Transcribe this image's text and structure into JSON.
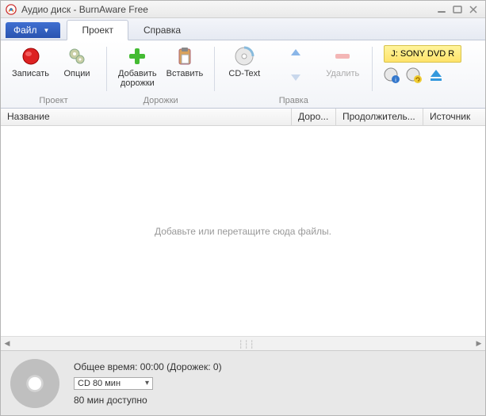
{
  "title": "Аудио диск - BurnAware Free",
  "tabs": {
    "file": "Файл",
    "project": "Проект",
    "help": "Справка"
  },
  "ribbon": {
    "burn": "Записать",
    "options": "Опции",
    "add_tracks": "Добавить\nдорожки",
    "paste": "Вставить",
    "cdtext": "CD-Text",
    "delete": "Удалить",
    "group_project": "Проект",
    "group_tracks": "Дорожки",
    "group_edit": "Правка",
    "drive": "J: SONY DVD R"
  },
  "headers": {
    "name": "Название",
    "track": "Доро...",
    "duration": "Продолжитель...",
    "source": "Источник"
  },
  "content_hint": "Добавьте или перетащите сюда файлы.",
  "footer": {
    "total": "Общее время: 00:00 (Дорожек: 0)",
    "disc_type": "CD 80 мин",
    "available": "80 мин доступно"
  }
}
